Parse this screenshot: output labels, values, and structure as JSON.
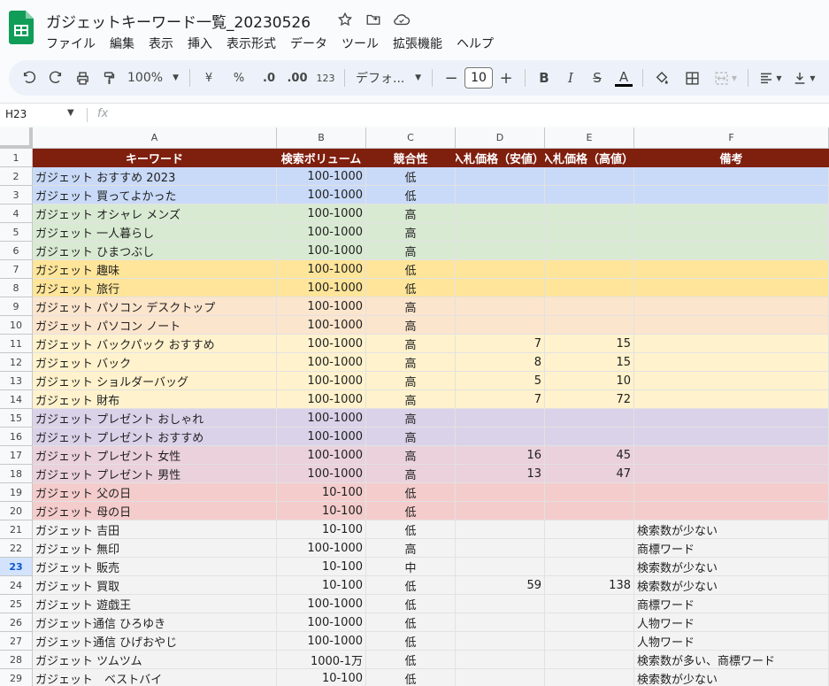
{
  "document": {
    "title": "ガジェットキーワード一覧_20230526"
  },
  "menu": [
    "ファイル",
    "編集",
    "表示",
    "挿入",
    "表示形式",
    "データ",
    "ツール",
    "拡張機能",
    "ヘルプ"
  ],
  "toolbar": {
    "zoom": "100%",
    "currency": "¥",
    "percent": "%",
    "decrease_decimal": ".0",
    "increase_decimal": ".00",
    "number_format": "123",
    "font": "デフォ...",
    "font_size": "10",
    "bold": "B",
    "italic": "I",
    "strikethrough": "S",
    "text_color": "A",
    "minus": "−",
    "plus": "+"
  },
  "formula_bar": {
    "name_box": "H23",
    "fx": "fx"
  },
  "columns": [
    "A",
    "B",
    "C",
    "D",
    "E",
    "F"
  ],
  "header_row": [
    "キーワード",
    "検索ボリューム",
    "競合性",
    "入札価格（安値）",
    "入札価格（高値）",
    "備考"
  ],
  "selected_row": "23",
  "rows": [
    {
      "num": "2",
      "color": "#c9daf8",
      "cells": [
        "ガジェット おすすめ 2023",
        "100-1000",
        "低",
        "",
        "",
        ""
      ]
    },
    {
      "num": "3",
      "color": "#c9daf8",
      "cells": [
        "ガジェット 買ってよかった",
        "100-1000",
        "低",
        "",
        "",
        ""
      ]
    },
    {
      "num": "4",
      "color": "#d9ead3",
      "cells": [
        "ガジェット オシャレ メンズ",
        "100-1000",
        "高",
        "",
        "",
        ""
      ]
    },
    {
      "num": "5",
      "color": "#d9ead3",
      "cells": [
        "ガジェット 一人暮らし",
        "100-1000",
        "高",
        "",
        "",
        ""
      ]
    },
    {
      "num": "6",
      "color": "#d9ead3",
      "cells": [
        "ガジェット ひまつぶし",
        "100-1000",
        "高",
        "",
        "",
        ""
      ]
    },
    {
      "num": "7",
      "color": "#ffe599",
      "cells": [
        "ガジェット 趣味",
        "100-1000",
        "低",
        "",
        "",
        ""
      ]
    },
    {
      "num": "8",
      "color": "#ffe599",
      "cells": [
        "ガジェット 旅行",
        "100-1000",
        "低",
        "",
        "",
        ""
      ]
    },
    {
      "num": "9",
      "color": "#fce5cd",
      "cells": [
        "ガジェット パソコン デスクトップ",
        "100-1000",
        "高",
        "",
        "",
        ""
      ]
    },
    {
      "num": "10",
      "color": "#fce5cd",
      "cells": [
        "ガジェット パソコン ノート",
        "100-1000",
        "高",
        "",
        "",
        ""
      ]
    },
    {
      "num": "11",
      "color": "#fff2cc",
      "cells": [
        "ガジェット バックパック おすすめ",
        "100-1000",
        "高",
        "7",
        "15",
        ""
      ]
    },
    {
      "num": "12",
      "color": "#fff2cc",
      "cells": [
        "ガジェット バック",
        "100-1000",
        "高",
        "8",
        "15",
        ""
      ]
    },
    {
      "num": "13",
      "color": "#fff2cc",
      "cells": [
        "ガジェット ショルダーバッグ",
        "100-1000",
        "高",
        "5",
        "10",
        ""
      ]
    },
    {
      "num": "14",
      "color": "#fff2cc",
      "cells": [
        "ガジェット 財布",
        "100-1000",
        "高",
        "7",
        "72",
        ""
      ]
    },
    {
      "num": "15",
      "color": "#d9d2e9",
      "cells": [
        "ガジェット プレゼント おしゃれ",
        "100-1000",
        "高",
        "",
        "",
        ""
      ]
    },
    {
      "num": "16",
      "color": "#d9d2e9",
      "cells": [
        "ガジェット プレゼント おすすめ",
        "100-1000",
        "高",
        "",
        "",
        ""
      ]
    },
    {
      "num": "17",
      "color": "#ead1dc",
      "cells": [
        "ガジェット プレゼント 女性",
        "100-1000",
        "高",
        "16",
        "45",
        ""
      ]
    },
    {
      "num": "18",
      "color": "#ead1dc",
      "cells": [
        "ガジェット プレゼント 男性",
        "100-1000",
        "高",
        "13",
        "47",
        ""
      ]
    },
    {
      "num": "19",
      "color": "#f4cccc",
      "cells": [
        "ガジェット 父の日",
        "10-100",
        "低",
        "",
        "",
        ""
      ]
    },
    {
      "num": "20",
      "color": "#f4cccc",
      "cells": [
        "ガジェット 母の日",
        "10-100",
        "低",
        "",
        "",
        ""
      ]
    },
    {
      "num": "21",
      "color": "#f3f3f3",
      "cells": [
        "ガジェット 吉田",
        "10-100",
        "低",
        "",
        "",
        "検索数が少ない"
      ]
    },
    {
      "num": "22",
      "color": "#f3f3f3",
      "cells": [
        "ガジェット 無印",
        "100-1000",
        "高",
        "",
        "",
        "商標ワード"
      ]
    },
    {
      "num": "23",
      "color": "#f3f3f3",
      "cells": [
        "ガジェット 販売",
        "10-100",
        "中",
        "",
        "",
        "検索数が少ない"
      ]
    },
    {
      "num": "24",
      "color": "#f3f3f3",
      "cells": [
        "ガジェット 買取",
        "10-100",
        "低",
        "59",
        "138",
        "検索数が少ない"
      ]
    },
    {
      "num": "25",
      "color": "#f3f3f3",
      "cells": [
        "ガジェット 遊戯王",
        "100-1000",
        "低",
        "",
        "",
        "商標ワード"
      ]
    },
    {
      "num": "26",
      "color": "#f3f3f3",
      "cells": [
        "ガジェット通信 ひろゆき",
        "100-1000",
        "低",
        "",
        "",
        "人物ワード"
      ]
    },
    {
      "num": "27",
      "color": "#f3f3f3",
      "cells": [
        "ガジェット通信 ひげおやじ",
        "100-1000",
        "低",
        "",
        "",
        "人物ワード"
      ]
    },
    {
      "num": "28",
      "color": "#f3f3f3",
      "cells": [
        "ガジェット ツムツム",
        "1000-1万",
        "低",
        "",
        "",
        "検索数が多い、商標ワード"
      ]
    },
    {
      "num": "29",
      "color": "#f3f3f3",
      "cells": [
        "ガジェット　ベストバイ",
        "10-100",
        "低",
        "",
        "",
        "検索数が少ない"
      ]
    }
  ],
  "colors": {
    "header_fill": "#7f1f0e",
    "selection": "#d3e3fd"
  }
}
